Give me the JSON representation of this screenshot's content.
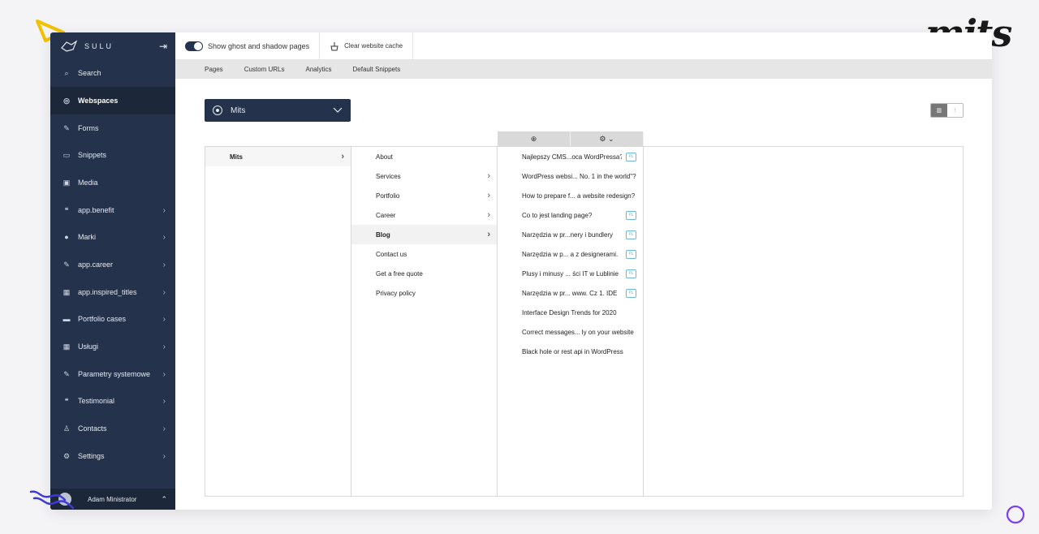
{
  "brand": {
    "logo_text": "mits"
  },
  "sidebar": {
    "brand": "SULU",
    "items": [
      {
        "icon": "search-icon",
        "label": "Search",
        "chevron": false,
        "active": false
      },
      {
        "icon": "globe-icon",
        "label": "Webspaces",
        "chevron": false,
        "active": true
      },
      {
        "icon": "pencil-icon",
        "label": "Forms",
        "chevron": false,
        "active": false
      },
      {
        "icon": "snippet-icon",
        "label": "Snippets",
        "chevron": false,
        "active": false
      },
      {
        "icon": "image-icon",
        "label": "Media",
        "chevron": false,
        "active": false
      },
      {
        "icon": "quote-icon",
        "label": "app.benefit",
        "chevron": true,
        "active": false
      },
      {
        "icon": "circle-icon",
        "label": "Marki",
        "chevron": true,
        "active": false
      },
      {
        "icon": "wrench-icon",
        "label": "app.career",
        "chevron": true,
        "active": false
      },
      {
        "icon": "calendar-icon",
        "label": "app.inspired_titles",
        "chevron": true,
        "active": false
      },
      {
        "icon": "briefcase-icon",
        "label": "Portfolio cases",
        "chevron": true,
        "active": false
      },
      {
        "icon": "calendar-icon",
        "label": "Usługi",
        "chevron": true,
        "active": false
      },
      {
        "icon": "wrench-icon",
        "label": "Parametry systemowe",
        "chevron": true,
        "active": false
      },
      {
        "icon": "quote-icon",
        "label": "Testimonial",
        "chevron": true,
        "active": false
      },
      {
        "icon": "user-icon",
        "label": "Contacts",
        "chevron": true,
        "active": false
      },
      {
        "icon": "gear-icon",
        "label": "Settings",
        "chevron": true,
        "active": false
      }
    ],
    "user": {
      "name": "Adam Ministrator"
    }
  },
  "toolbar": {
    "ghost_label": "Show ghost and shadow pages",
    "cache_label": "Clear website cache"
  },
  "tabs": [
    {
      "label": "Pages",
      "active": true
    },
    {
      "label": "Custom URLs",
      "active": false
    },
    {
      "label": "Analytics",
      "active": false
    },
    {
      "label": "Default Snippets",
      "active": false
    }
  ],
  "webspace": {
    "selected": "Mits"
  },
  "columns": {
    "col1": [
      {
        "label": "Mits",
        "chevron": true,
        "selected": true
      }
    ],
    "col2": [
      {
        "label": "About",
        "chevron": false,
        "selected": false
      },
      {
        "label": "Services",
        "chevron": true,
        "selected": false
      },
      {
        "label": "Portfolio",
        "chevron": true,
        "selected": false
      },
      {
        "label": "Career",
        "chevron": true,
        "selected": false
      },
      {
        "label": "Blog",
        "chevron": true,
        "selected": true
      },
      {
        "label": "Contact us",
        "chevron": false,
        "selected": false
      },
      {
        "label": "Get a free quote",
        "chevron": false,
        "selected": false
      },
      {
        "label": "Privacy policy",
        "chevron": false,
        "selected": false
      }
    ],
    "col3": [
      {
        "label": "Najlepszy CMS...oca WordPressa?",
        "tag": "PL"
      },
      {
        "label": "WordPress websi... No. 1 in the world\"?",
        "tag": ""
      },
      {
        "label": "How to prepare f... a website redesign?",
        "tag": ""
      },
      {
        "label": "Co to jest landing page?",
        "tag": "PL"
      },
      {
        "label": "Narzędzia w pr...nery i bundlery",
        "tag": "PL"
      },
      {
        "label": "Narzędzia w p... a z designerami.",
        "tag": "PL"
      },
      {
        "label": "Plusy i minusy ... ści IT w Lublinie",
        "tag": "PL"
      },
      {
        "label": "Narzędzia w pr... www. Cz 1. IDE",
        "tag": "PL"
      },
      {
        "label": "Interface Design Trends for 2020",
        "tag": ""
      },
      {
        "label": "Correct messages... ly on your website",
        "tag": ""
      },
      {
        "label": "Black hole or rest api in WordPress",
        "tag": ""
      }
    ]
  },
  "colors": {
    "sidebar": "#25324b",
    "sidebar_active": "#1c2739",
    "tag": "#6db6d8"
  }
}
